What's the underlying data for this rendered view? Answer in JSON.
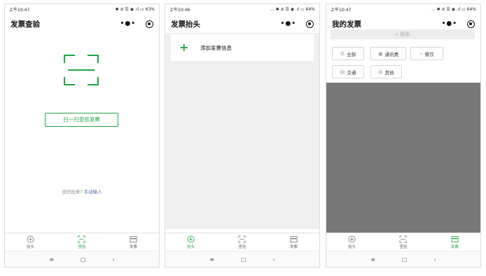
{
  "colors": {
    "accent": "#21a642",
    "link": "#4a6fa5",
    "overlay": "#787878"
  },
  "screens": [
    {
      "status": {
        "time": "上午10:47",
        "right": "✱ ⊘ ☰ ◉ .ıl ▭ 63%"
      },
      "title": "发票查验",
      "nav_dots": "•●•",
      "scan_button": "扫一扫查验发票",
      "manual_prefix": "没扫出来?",
      "manual_link": "手动输入"
    },
    {
      "status": {
        "time": "上午10:46",
        "right": "... ✱ ⊘ ☰ ◉ .ıl ▭ 64%"
      },
      "title": "发票抬头",
      "nav_dots": "•●•",
      "add_label": "添加发票信息"
    },
    {
      "status": {
        "time": "上午10:47",
        "right": "... ✱ ⊘ ☰ ◉ .ıl ▭ 64%"
      },
      "title": "我的发票",
      "nav_dots": "•●•",
      "search_placeholder": "搜索",
      "chips": [
        {
          "icon": "☰",
          "label": "全部"
        },
        {
          "icon": "▣",
          "label": "通讯费"
        },
        {
          "icon": "⌁",
          "label": "餐饮"
        },
        {
          "icon": "▤",
          "label": "交通"
        },
        {
          "icon": "⊞",
          "label": "其他"
        }
      ]
    }
  ],
  "tabs": [
    "抬头",
    "查验",
    "发票"
  ],
  "sysnav": {
    "menu": "≡",
    "home": "▢",
    "back": "‹"
  }
}
